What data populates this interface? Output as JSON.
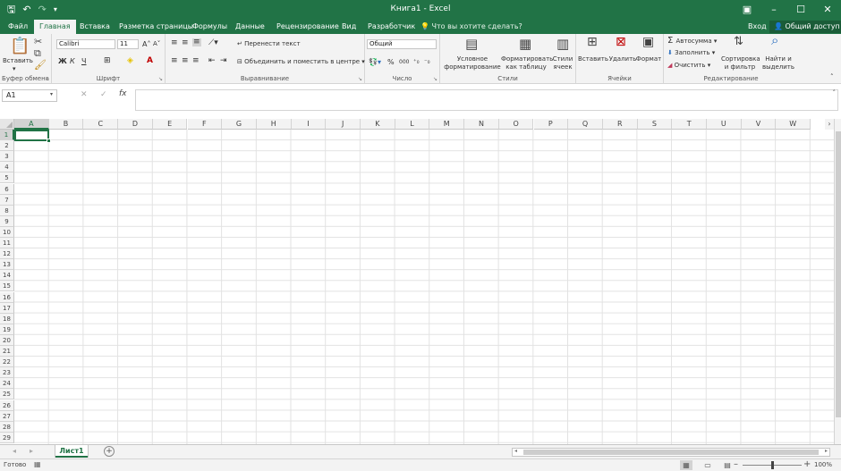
{
  "window": {
    "title": "Книга1 - Excel",
    "controls": [
      "ribbon-options-icon",
      "minimize-icon",
      "maximize-icon",
      "close-icon"
    ]
  },
  "qat": {
    "save_icon": "save-icon",
    "undo_icon": "undo-icon",
    "redo_icon": "redo-icon",
    "customize_icon": "customize-qat-icon"
  },
  "tabs": [
    {
      "label": "Файл",
      "active": false
    },
    {
      "label": "Главная",
      "active": true
    },
    {
      "label": "Вставка",
      "active": false
    },
    {
      "label": "Разметка страницы",
      "active": false
    },
    {
      "label": "Формулы",
      "active": false
    },
    {
      "label": "Данные",
      "active": false
    },
    {
      "label": "Рецензирование",
      "active": false
    },
    {
      "label": "Вид",
      "active": false
    },
    {
      "label": "Разработчик",
      "active": false
    }
  ],
  "tell_me": "Что вы хотите сделать?",
  "login": "Вход",
  "share": "Общий доступ",
  "ribbon": {
    "clipboard": {
      "label": "Буфер обмена",
      "paste": "Вставить"
    },
    "font": {
      "label": "Шрифт",
      "font_name": "Calibri",
      "font_size": "11",
      "bold": "Ж",
      "italic": "К",
      "underline": "Ч"
    },
    "alignment": {
      "label": "Выравнивание",
      "wrap": "Перенести текст",
      "merge": "Объединить и поместить в центре"
    },
    "number": {
      "label": "Число",
      "format": "Общий",
      "percent": "%",
      "thousands": "000"
    },
    "styles": {
      "label": "Стили",
      "conditional": [
        "Условное",
        "форматирование"
      ],
      "as_table": [
        "Форматировать",
        "как таблицу"
      ],
      "cell_styles": [
        "Стили",
        "ячеек"
      ]
    },
    "cells": {
      "label": "Ячейки",
      "insert": "Вставить",
      "delete": "Удалить",
      "format": "Формат"
    },
    "editing": {
      "label": "Редактирование",
      "autosum": "Автосумма",
      "fill": "Заполнить",
      "clear": "Очистить",
      "sort": [
        "Сортировка",
        "и фильтр"
      ],
      "find": [
        "Найти и",
        "выделить"
      ]
    }
  },
  "formula_bar": {
    "name_box": "A1",
    "fx": "fx",
    "formula": ""
  },
  "grid": {
    "columns": [
      "A",
      "B",
      "C",
      "D",
      "E",
      "F",
      "G",
      "H",
      "I",
      "J",
      "K",
      "L",
      "M",
      "N",
      "O",
      "P",
      "Q",
      "R",
      "S",
      "T",
      "U",
      "V",
      "W"
    ],
    "rows": [
      "1",
      "2",
      "3",
      "4",
      "5",
      "6",
      "7",
      "8",
      "9",
      "10",
      "11",
      "12",
      "13",
      "14",
      "15",
      "16",
      "17",
      "18",
      "19",
      "20",
      "21",
      "22",
      "23",
      "24",
      "25",
      "26",
      "27",
      "28",
      "29"
    ],
    "active_cell": "A1"
  },
  "sheets": [
    {
      "label": "Лист1",
      "active": true
    }
  ],
  "status": {
    "text": "Готово",
    "zoom": "100%"
  }
}
